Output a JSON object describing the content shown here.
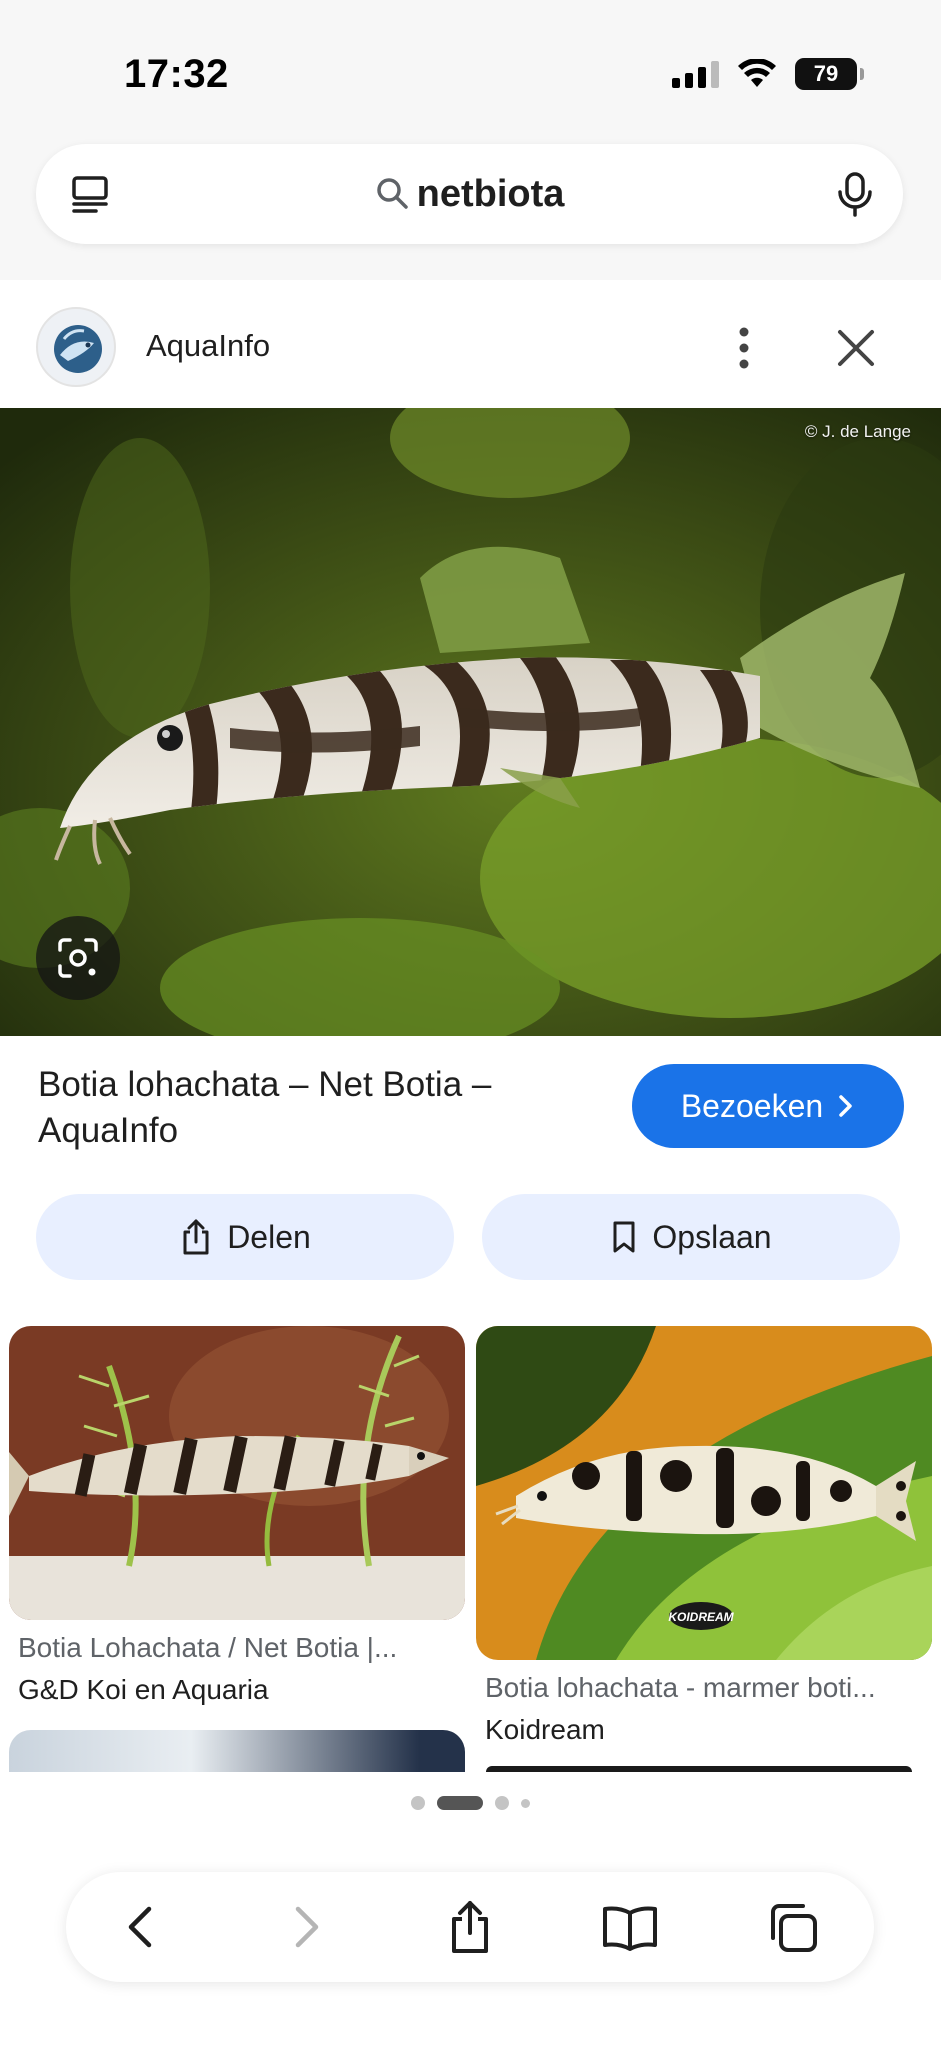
{
  "status_bar": {
    "time": "17:32",
    "battery": "79",
    "icons": [
      "signal-icon",
      "wifi-icon",
      "battery-icon"
    ]
  },
  "search": {
    "query": "netbiota",
    "icons": [
      "tabs-icon",
      "search-icon",
      "mic-icon"
    ]
  },
  "source": {
    "name": "AquaInfo",
    "icons": [
      "site-logo",
      "more-options-icon",
      "close-icon"
    ]
  },
  "hero": {
    "credit": "© J. de Lange",
    "lens_icon": "google-lens-icon"
  },
  "result": {
    "title": "Botia lohachata – Net Botia – AquaInfo",
    "visit_label": "Bezoeken",
    "share_label": "Delen",
    "save_label": "Opslaan"
  },
  "related": [
    {
      "title": "Botia Lohachata / Net Botia |...",
      "source": "G&D Koi en Aquaria"
    },
    {
      "title": "Botia lohachata - marmer boti...",
      "source": "Koidream",
      "image_label": "KOIDREAM"
    }
  ],
  "pagination": {
    "count": 4,
    "active_index": 1
  },
  "toolbar": {
    "icons": [
      "back-icon",
      "forward-icon",
      "share-icon",
      "bookmarks-icon",
      "tabs-overview-icon"
    ]
  },
  "colors": {
    "accent": "#1a73e8",
    "pill_background": "#e8efff",
    "chrome_background": "#f7f7f7"
  }
}
